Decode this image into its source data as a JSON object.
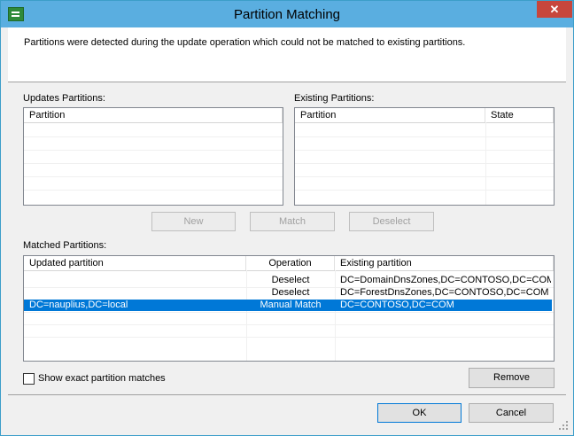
{
  "window": {
    "title": "Partition Matching",
    "close_glyph": "✕"
  },
  "header": {
    "description": "Partitions were detected during the update operation which could not be matched to existing partitions."
  },
  "updates_partitions": {
    "label": "Updates Partitions:",
    "columns": [
      "Partition"
    ]
  },
  "existing_partitions": {
    "label": "Existing Partitions:",
    "columns": [
      "Partition",
      "State"
    ]
  },
  "actions": {
    "new_label": "New",
    "match_label": "Match",
    "deselect_label": "Deselect"
  },
  "matched_partitions": {
    "label": "Matched Partitions:",
    "columns": [
      "Updated partition",
      "Operation",
      "Existing partition"
    ],
    "rows": [
      {
        "updated": "",
        "operation": "Deselect",
        "existing": "DC=DomainDnsZones,DC=CONTOSO,DC=COM",
        "selected": false
      },
      {
        "updated": "",
        "operation": "Deselect",
        "existing": "DC=ForestDnsZones,DC=CONTOSO,DC=COM",
        "selected": false
      },
      {
        "updated": "DC=nauplius,DC=local",
        "operation": "Manual Match",
        "existing": "DC=CONTOSO,DC=COM",
        "selected": true
      }
    ]
  },
  "options": {
    "show_exact_label": "Show exact partition matches",
    "show_exact_checked": false
  },
  "buttons": {
    "remove_label": "Remove",
    "ok_label": "OK",
    "cancel_label": "Cancel"
  },
  "colors": {
    "titlebar": "#5aaee0",
    "selection": "#0078d7",
    "close": "#c7463c"
  }
}
